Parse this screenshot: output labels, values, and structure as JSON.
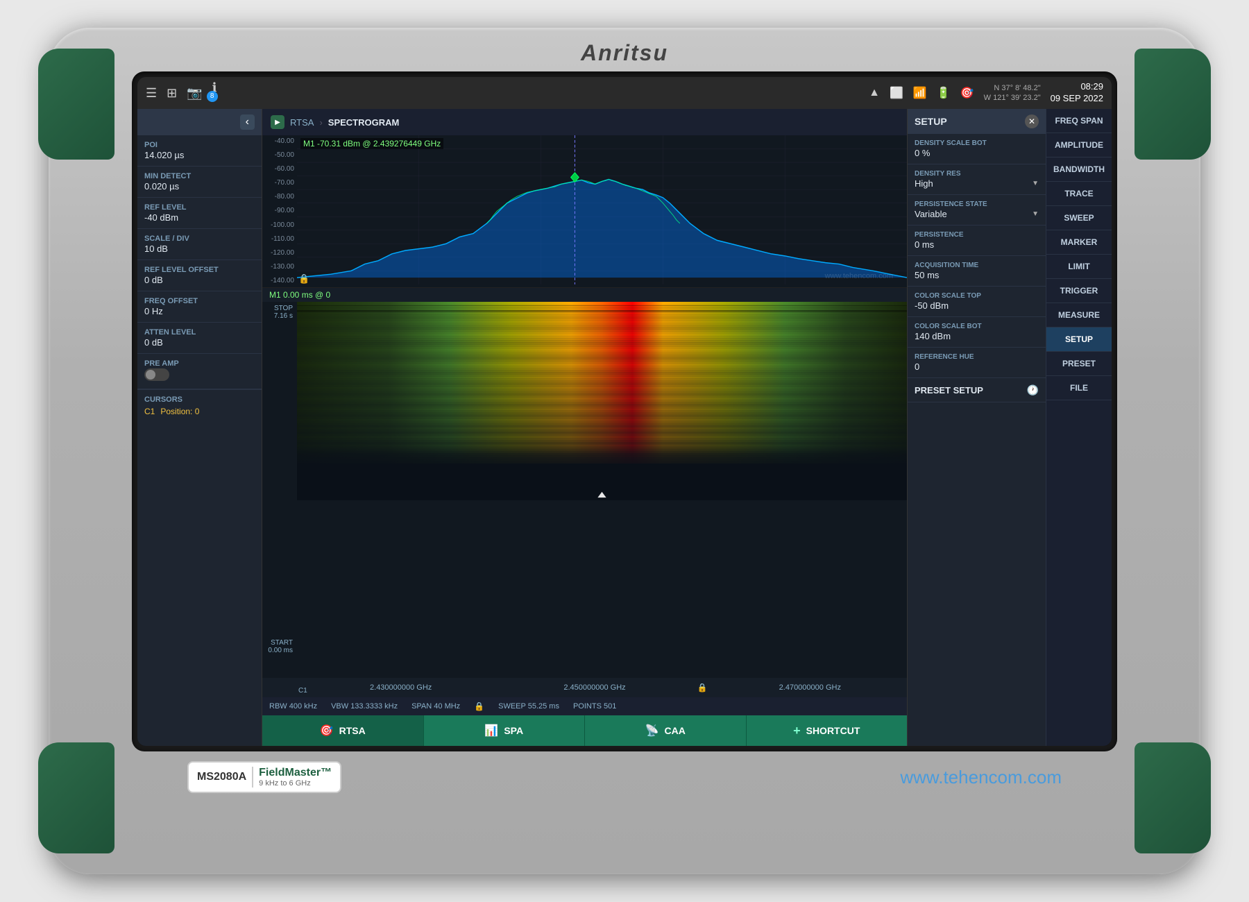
{
  "device": {
    "brand": "Anritsu",
    "model": "MS2080A",
    "product_name": "FieldMaster™",
    "freq_range": "9 kHz to 6 GHz",
    "website": "www.tehencom.com"
  },
  "top_bar": {
    "gps": "N 37° 8' 48.2\"",
    "gps2": "W 121° 39' 23.2\"",
    "time": "08:29",
    "date": "09 SEP 2022",
    "badge": "8"
  },
  "breadcrumb": {
    "root": "RTSA",
    "separator": "›",
    "current": "SPECTROGRAM"
  },
  "left_panel": {
    "params": [
      {
        "label": "POI",
        "value": "14.020 µs"
      },
      {
        "label": "MIN DETECT",
        "value": "0.020 µs"
      },
      {
        "label": "REF LEVEL",
        "value": "-40 dBm"
      },
      {
        "label": "SCALE / DIV",
        "value": "10 dB"
      },
      {
        "label": "REF LEVEL OFFSET",
        "value": "0 dB"
      },
      {
        "label": "FREQ OFFSET",
        "value": "0 Hz"
      },
      {
        "label": "ATTEN LEVEL",
        "value": "0 dB"
      },
      {
        "label": "PRE AMP",
        "value": ""
      }
    ],
    "cursors_label": "CURSORS",
    "cursor_c1": "C1",
    "cursor_position": "Position: 0"
  },
  "spectrum": {
    "marker_label": "M1  -70.31 dBm @ 2.439276449 GHz",
    "y_labels": [
      "-40.00",
      "-50.00",
      "-60.00",
      "-70.00",
      "-80.00",
      "-90.00",
      "-100.00",
      "-110.00",
      "-120.00",
      "-130.00",
      "-140.00"
    ],
    "watermark": "www.tehencom.com"
  },
  "spectrogram": {
    "header_label": "M1 0.00 ms @ 0",
    "stop_label": "STOP",
    "stop_value": "7.16 s",
    "start_label": "START",
    "start_value": "0.00 ms"
  },
  "freq_bar": {
    "freq1": "2.430000000 GHz",
    "freq2": "2.450000000 GHz",
    "freq3": "2.470000000 GHz",
    "c1_label": "C1"
  },
  "status_bar": {
    "rbw": "RBW 400 kHz",
    "vbw": "VBW 133.3333 kHz",
    "span": "SPAN 40 MHz",
    "sweep": "SWEEP  55.25 ms",
    "points": "POINTS 501"
  },
  "bottom_nav": {
    "items": [
      {
        "icon": "🎯",
        "label": "RTSA"
      },
      {
        "icon": "📊",
        "label": "SPA"
      },
      {
        "icon": "📡",
        "label": "CAA"
      },
      {
        "icon": "+",
        "label": "SHORTCUT"
      }
    ]
  },
  "setup_panel": {
    "title": "SETUP",
    "items": [
      {
        "label": "DENSITY SCALE BOT",
        "value": "0 %"
      },
      {
        "label": "DENSITY RES",
        "value": "High"
      },
      {
        "label": "PERSISTENCE STATE",
        "value": "Variable"
      },
      {
        "label": "PERSISTENCE",
        "value": "0 ms"
      },
      {
        "label": "ACQUISITION TIME",
        "value": "50 ms"
      },
      {
        "label": "COLOR SCALE TOP",
        "value": "-50 dBm"
      },
      {
        "label": "COLOR SCALE BOT",
        "value": "140 dBm"
      },
      {
        "label": "REFERENCE HUE",
        "value": "0"
      },
      {
        "label": "PRESET SETUP",
        "value": ""
      }
    ]
  },
  "right_menu": {
    "items": [
      "FREQ SPAN",
      "AMPLITUDE",
      "BANDWIDTH",
      "TRACE",
      "SWEEP",
      "MARKER",
      "LIMIT",
      "TRIGGER",
      "MEASURE",
      "SETUP",
      "PRESET",
      "FILE"
    ]
  }
}
